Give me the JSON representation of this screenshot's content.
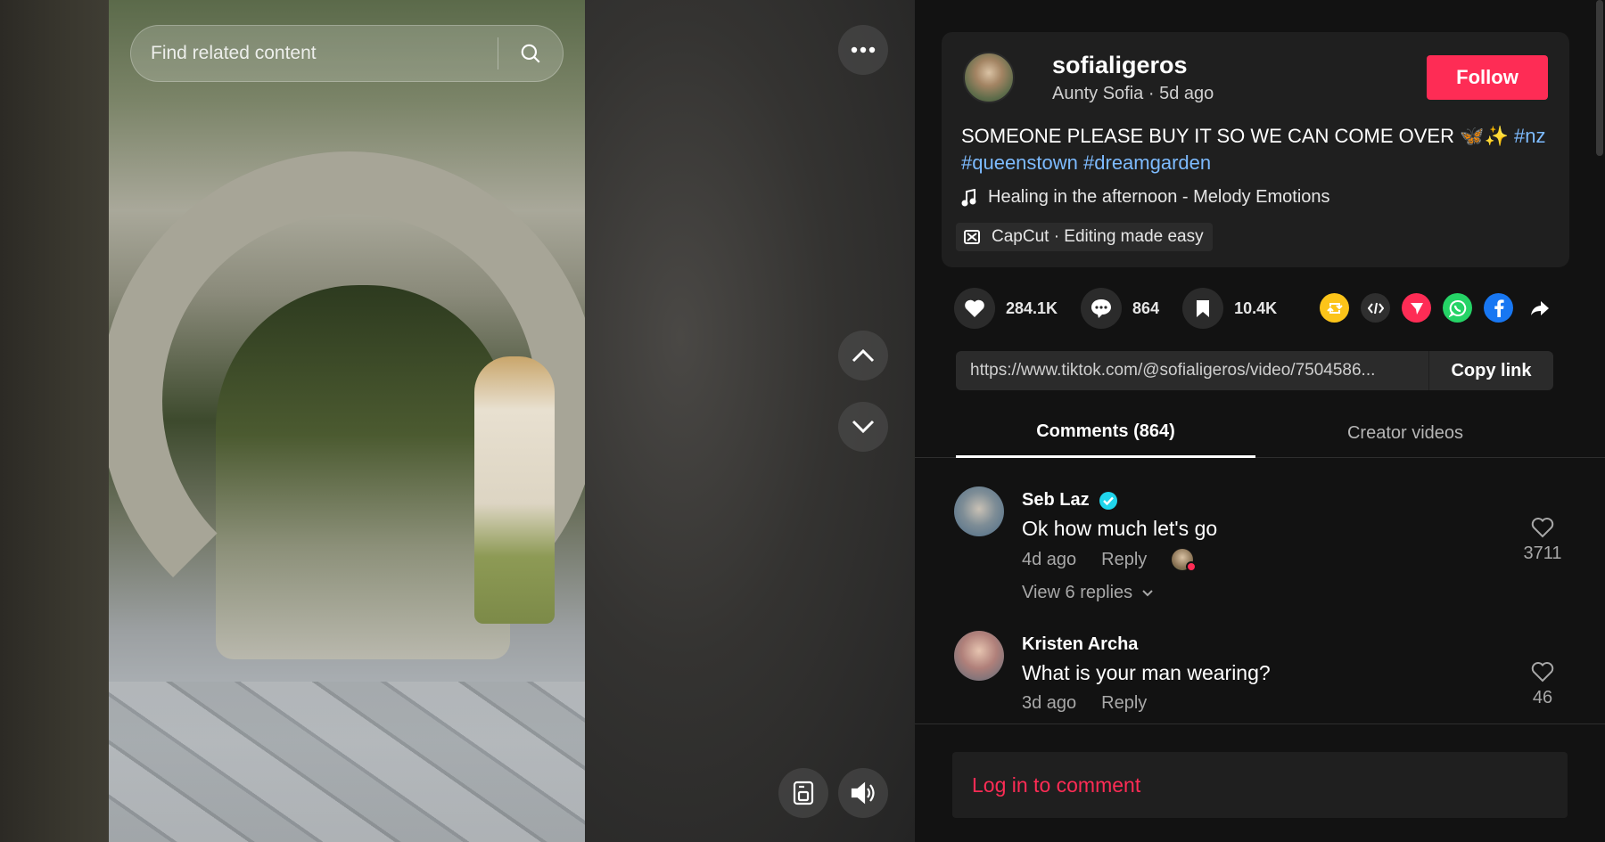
{
  "search": {
    "placeholder": "Find related content"
  },
  "author": {
    "username": "sofialigeros",
    "display_name": "Aunty Sofia",
    "posted": "5d ago",
    "follow_label": "Follow"
  },
  "post": {
    "caption": "SOMEONE PLEASE BUY IT SO WE CAN COME OVER 🦋✨",
    "hashtags": [
      "#nz",
      "#queenstown",
      "#dreamgarden"
    ],
    "music": "Healing in the afternoon - Melody Emotions",
    "capcut": "CapCut · Editing made easy"
  },
  "stats": {
    "likes": "284.1K",
    "comments": "864",
    "saves": "10.4K"
  },
  "share": {
    "url": "https://www.tiktok.com/@sofialigeros/video/7504586...",
    "copy_label": "Copy link"
  },
  "tabs": {
    "comments": "Comments (864)",
    "creator": "Creator videos"
  },
  "comments": [
    {
      "name": "Seb Laz",
      "text": "Ok how much let's go",
      "time": "4d ago",
      "reply": "Reply",
      "likes": "3711",
      "view_replies": "View 6 replies"
    },
    {
      "name": "Kristen Archa",
      "text": "What is your man wearing?",
      "time": "3d ago",
      "reply": "Reply",
      "likes": "46"
    }
  ],
  "login_prompt": "Log in to comment",
  "colors": {
    "accent": "#fe2c55",
    "hashtag": "#7dbbff",
    "verified": "#20d5ec"
  }
}
